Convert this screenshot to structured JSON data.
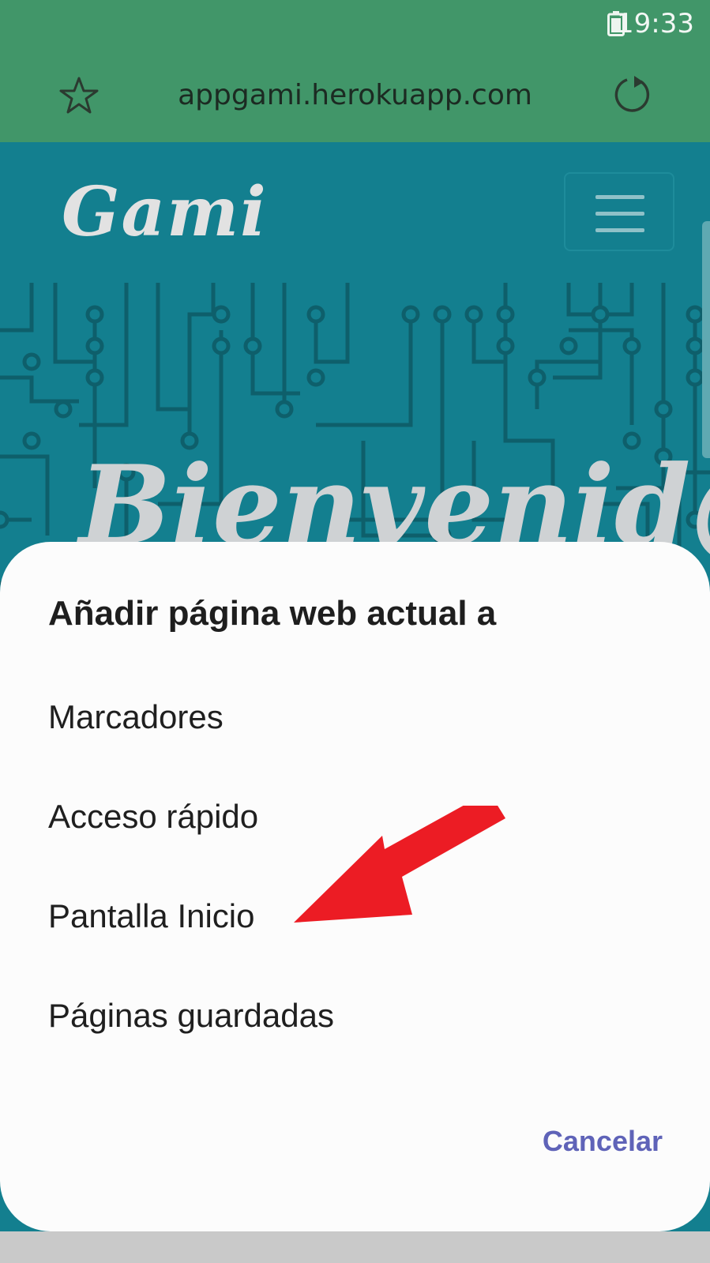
{
  "status_bar": {
    "time": "19:33",
    "battery_icon": "battery-icon"
  },
  "browser": {
    "url": "appgami.herokuapp.com",
    "bookmark_icon": "star-icon",
    "reload_icon": "reload-icon"
  },
  "page": {
    "logo": "Gami",
    "menu_icon": "hamburger-menu-icon",
    "headline": "Bienvenid@s"
  },
  "dialog": {
    "title": "Añadir página web actual a",
    "options": [
      {
        "label": "Marcadores"
      },
      {
        "label": "Acceso rápido"
      },
      {
        "label": "Pantalla Inicio"
      },
      {
        "label": "Páginas guardadas"
      }
    ],
    "cancel_label": "Cancelar"
  },
  "colors": {
    "status_green": "#419669",
    "page_teal": "#137f8f",
    "arrow_red": "#ec1c24",
    "cancel_blue": "#5f63b8"
  }
}
